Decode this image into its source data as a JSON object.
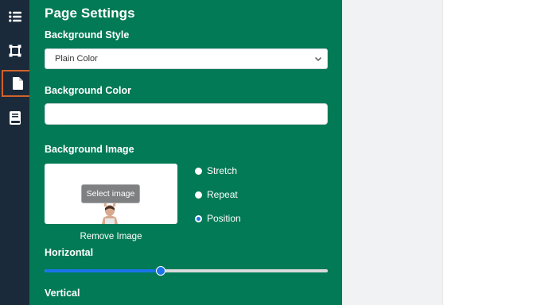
{
  "sidebar": {
    "icons": [
      "list-icon",
      "frame-icon",
      "page-icon",
      "book-icon"
    ],
    "active": "page-icon",
    "active_outline_color": "#d2622a",
    "background": "#1b2a3b"
  },
  "panel": {
    "title": "Page Settings",
    "background": "#027a55",
    "background_style": {
      "label": "Background Style",
      "value": "Plain Color"
    },
    "background_color": {
      "label": "Background Color",
      "value": ""
    },
    "background_image": {
      "label": "Background Image",
      "select_label": "Select image",
      "remove_label": "Remove Image"
    },
    "image_mode": {
      "options": [
        {
          "label": "Stretch",
          "checked": false
        },
        {
          "label": "Repeat",
          "checked": false
        },
        {
          "label": "Position",
          "checked": true
        }
      ]
    },
    "horizontal": {
      "label": "Horizontal",
      "value_fraction": 0.41,
      "accent": "#1a73e8"
    },
    "vertical": {
      "label": "Vertical"
    }
  }
}
